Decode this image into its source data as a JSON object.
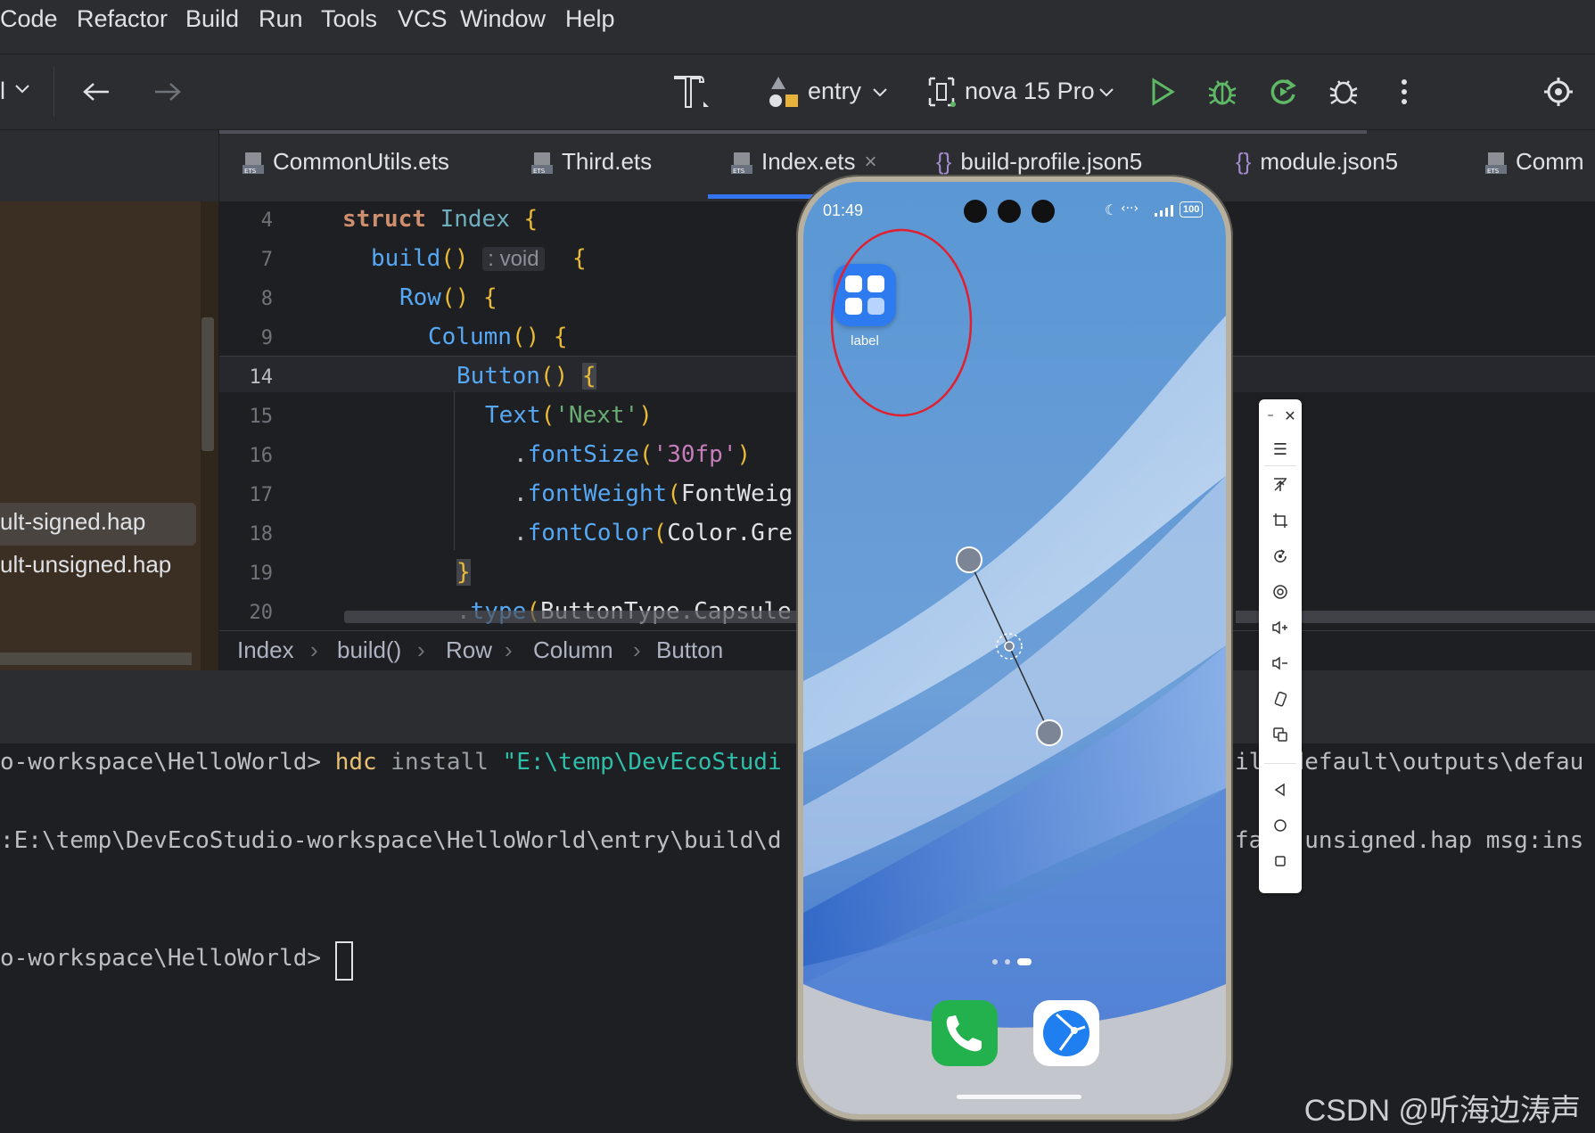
{
  "menubar": {
    "items": [
      "Code",
      "Refactor",
      "Build",
      "Run",
      "Tools",
      "VCS",
      "Window",
      "Help"
    ]
  },
  "toolbar": {
    "left_dropdown": "l",
    "run_config": "entry",
    "device": "nova 15 Pro",
    "icons": [
      "chevron-down-icon",
      "back-arrow-icon",
      "forward-arrow-icon",
      "hammer-icon",
      "entry-module-icon",
      "device-icon",
      "run-icon",
      "debug-icon",
      "rerun-icon",
      "attach-debugger-icon",
      "more-icon",
      "settings-icon"
    ]
  },
  "project": {
    "files": [
      "ult-signed.hap",
      "ult-unsigned.hap"
    ]
  },
  "tabs": [
    {
      "label": "CommonUtils.ets",
      "icon": "ets-file-icon"
    },
    {
      "label": "Third.ets",
      "icon": "ets-file-icon"
    },
    {
      "label": "Index.ets",
      "icon": "ets-file-icon",
      "active": true,
      "close": "×"
    },
    {
      "label": "build-profile.json5",
      "icon": "json-braces-icon"
    },
    {
      "label": "module.json5",
      "icon": "json-braces-icon"
    },
    {
      "label": "Comm",
      "icon": "ets-file-icon"
    }
  ],
  "editor": {
    "lines": [
      {
        "num": "4",
        "code": "struct Index {"
      },
      {
        "num": "7",
        "code": "build() : void  {"
      },
      {
        "num": "8",
        "code": "Row() {"
      },
      {
        "num": "9",
        "code": "Column() {"
      },
      {
        "num": "14",
        "code": "Button() {"
      },
      {
        "num": "15",
        "code": "Text('Next')"
      },
      {
        "num": "16",
        "code": ".fontSize('30fp')"
      },
      {
        "num": "17",
        "code": ".fontWeight(FontWeig"
      },
      {
        "num": "18",
        "code": ".fontColor(Color.Gre"
      },
      {
        "num": "19",
        "code": "}"
      },
      {
        "num": "20",
        "code": ".type(ButtonType.Capsule"
      }
    ],
    "inlay_hint": ": void"
  },
  "breadcrumb": [
    "Index",
    "build()",
    "Row",
    "Column",
    "Button"
  ],
  "terminal": {
    "line1_prefix": "o-workspace\\HelloWorld> ",
    "line1_cmd": "hdc",
    "line1_mid": " install ",
    "line1_path": "\"E:\\temp\\DevEcoStudi",
    "line1_tail": "il  default\\outputs\\defau",
    "line2": ":E:\\temp\\DevEcoStudio-workspace\\HelloWorld\\entry\\build\\d",
    "line2_tail": "fa  -unsigned.hap msg:ins",
    "line3": "o-workspace\\HelloWorld> "
  },
  "phone": {
    "time": "01:49",
    "battery": "100",
    "app_label": "label",
    "dock_apps": [
      "phone-app-icon",
      "browser-app-icon"
    ],
    "annotation_color": "#e0202e"
  },
  "side_toolbar": {
    "icons": [
      "minimize-icon",
      "close-icon",
      "menu-icon",
      "pin-top-icon",
      "crop-icon",
      "rotate-icon",
      "screenshot-icon",
      "volume-up-icon",
      "volume-down-icon",
      "shake-icon",
      "multi-window-icon",
      "back-nav-icon",
      "home-nav-icon",
      "recent-nav-icon"
    ]
  },
  "watermark": "CSDN @听海边涛声"
}
